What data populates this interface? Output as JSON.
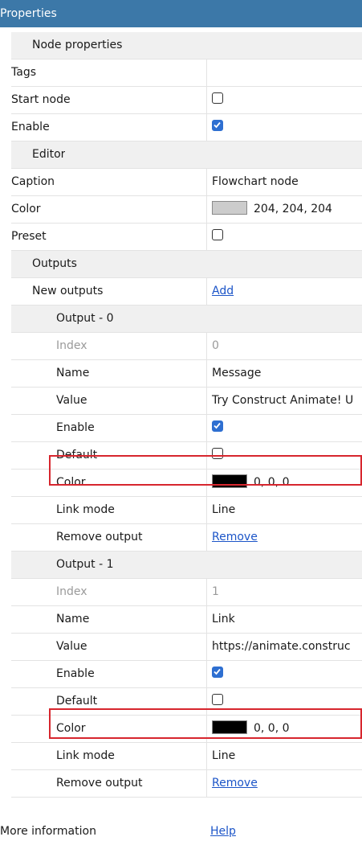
{
  "header": {
    "title": "Properties"
  },
  "node_properties": {
    "category": "Node properties",
    "tags_label": "Tags",
    "tags_value": "",
    "start_node_label": "Start node",
    "start_node_checked": false,
    "enable_label": "Enable",
    "enable_checked": true
  },
  "editor": {
    "category": "Editor",
    "caption_label": "Caption",
    "caption_value": "Flowchart node",
    "color_label": "Color",
    "color_value": "204, 204, 204",
    "color_swatch": "#cccccc",
    "preset_label": "Preset",
    "preset_checked": false
  },
  "outputs": {
    "category": "Outputs",
    "new_outputs_label": "New outputs",
    "add_link": "Add",
    "items": [
      {
        "title": "Output - 0",
        "index_label": "Index",
        "index_value": "0",
        "name_label": "Name",
        "name_value": "Message",
        "value_label": "Value",
        "value_value": "Try Construct Animate! U",
        "enable_label": "Enable",
        "enable_checked": true,
        "default_label": "Default",
        "default_checked": false,
        "color_label": "Color",
        "color_value": "0, 0, 0",
        "color_swatch": "#000000",
        "link_mode_label": "Link mode",
        "link_mode_value": "Line",
        "remove_label": "Remove output",
        "remove_link": "Remove"
      },
      {
        "title": "Output - 1",
        "index_label": "Index",
        "index_value": "1",
        "name_label": "Name",
        "name_value": "Link",
        "value_label": "Value",
        "value_value": "https://animate.construc",
        "enable_label": "Enable",
        "enable_checked": true,
        "default_label": "Default",
        "default_checked": false,
        "color_label": "Color",
        "color_value": "0, 0, 0",
        "color_swatch": "#000000",
        "link_mode_label": "Link mode",
        "link_mode_value": "Line",
        "remove_label": "Remove output",
        "remove_link": "Remove"
      }
    ]
  },
  "more_information": {
    "label": "More information",
    "link": "Help"
  },
  "colors": {
    "header_bg": "#3c78a8",
    "checkbox_on": "#2e6fd1",
    "link": "#1c55c8",
    "highlight": "#d7262e"
  }
}
